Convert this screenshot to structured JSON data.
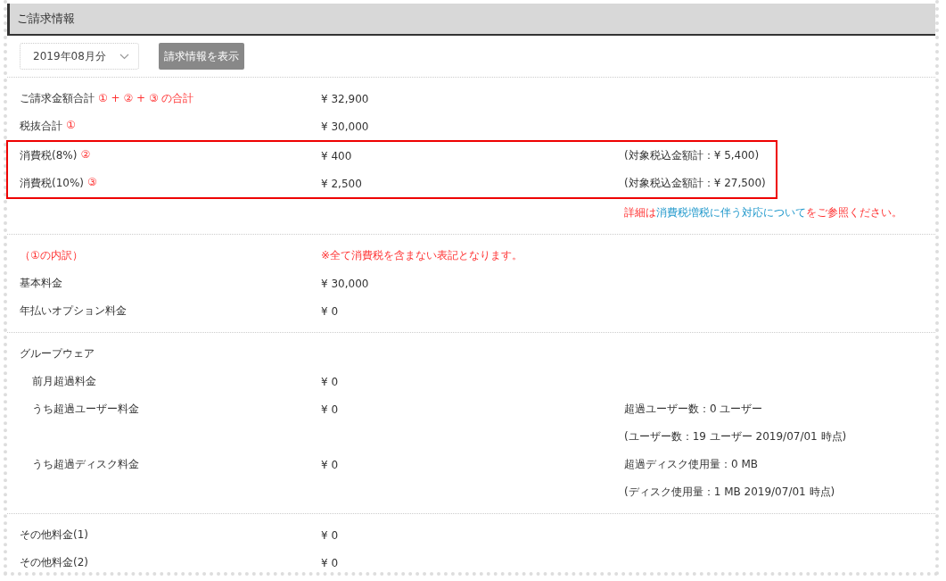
{
  "panel": {
    "title": "ご請求情報"
  },
  "toolbar": {
    "month_select": {
      "value": "2019年08月分"
    },
    "show_button": {
      "label": "請求情報を表示"
    }
  },
  "sections": [
    {
      "blocks": [
        {
          "highlighted": false,
          "rows": [
            {
              "label": "ご請求金額合計",
              "label_note": "① + ② + ③ の合計",
              "value": "¥ 32,900"
            },
            {
              "label": "税抜合計",
              "label_note": "①",
              "value": "¥ 30,000"
            }
          ]
        },
        {
          "highlighted": true,
          "rows": [
            {
              "label": "消費税(8%)",
              "label_note": "②",
              "value": "¥ 400",
              "note": "(対象税込金額計：¥ 5,400)"
            },
            {
              "label": "消費税(10%)",
              "label_note": "③",
              "value": "¥ 2,500",
              "note": "(対象税込金額計：¥ 27,500)"
            }
          ]
        },
        {
          "highlighted": false,
          "rows": [
            {
              "notice": {
                "before": "詳細は",
                "link": "消費税増税に伴う対応について",
                "after": "をご参照ください。"
              }
            }
          ]
        }
      ]
    },
    {
      "blocks": [
        {
          "highlighted": false,
          "rows": [
            {
              "label": "（①の内訳）",
              "label_alert": true,
              "value": "※全て消費税を含まない表記となります。",
              "value_alert": true
            },
            {
              "label": "基本料金",
              "value": "¥ 30,000"
            },
            {
              "label": "年払いオプション料金",
              "value": "¥ 0"
            }
          ]
        }
      ]
    },
    {
      "blocks": [
        {
          "highlighted": false,
          "rows": [
            {
              "label": "グループウェア",
              "children": [
                {
                  "label": "前月超過料金",
                  "value": "¥ 0"
                },
                {
                  "label": "うち超過ユーザー料金",
                  "value": "¥ 0",
                  "note": "超過ユーザー数：0 ユーザー"
                },
                {
                  "note": "(ユーザー数：19 ユーザー 2019/07/01 時点)"
                },
                {
                  "label": "うち超過ディスク料金",
                  "value": "¥ 0",
                  "note": "超過ディスク使用量：0 MB"
                },
                {
                  "note": "(ディスク使用量：1 MB 2019/07/01 時点)"
                }
              ]
            }
          ]
        }
      ]
    },
    {
      "blocks": [
        {
          "highlighted": false,
          "rows": [
            {
              "label": "その他料金(1)",
              "value": "¥ 0"
            },
            {
              "label": "その他料金(2)",
              "value": "¥ 0"
            }
          ]
        }
      ]
    }
  ]
}
